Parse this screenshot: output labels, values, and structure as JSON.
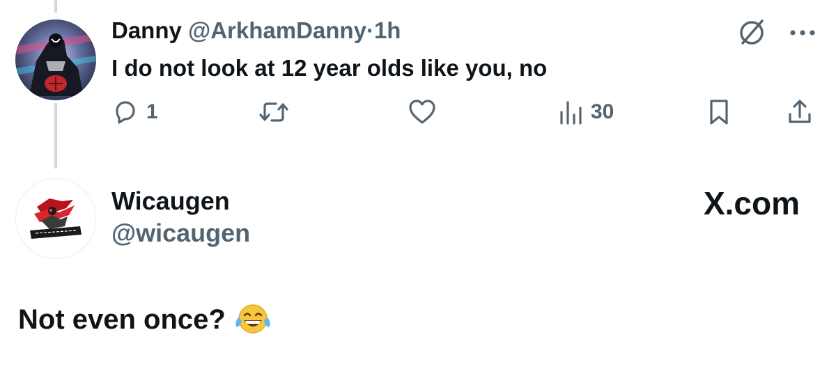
{
  "reply": {
    "author_name": "Danny",
    "author_handle": "@ArkhamDanny",
    "separator": "·",
    "time_ago": "1h",
    "text": "I do not look at 12 year olds like you, no",
    "actions": {
      "reply_count": "1",
      "retweet_count": "",
      "like_count": "",
      "views_count": "30"
    },
    "icons": [
      "grok-icon",
      "more-icon",
      "reply-icon",
      "retweet-icon",
      "like-icon",
      "views-icon",
      "bookmark-icon",
      "share-icon"
    ]
  },
  "quoted": {
    "author_name": "Wicaugen",
    "author_handle": "@wicaugen",
    "brand": "X.com",
    "text": "Not even once?",
    "emoji": "face-with-tears-of-joy",
    "avatar_text": "WICAUGEN"
  },
  "colors": {
    "text": "#0f1419",
    "secondary": "#536471",
    "thread_line": "#cfd9de",
    "background": "#ffffff"
  }
}
